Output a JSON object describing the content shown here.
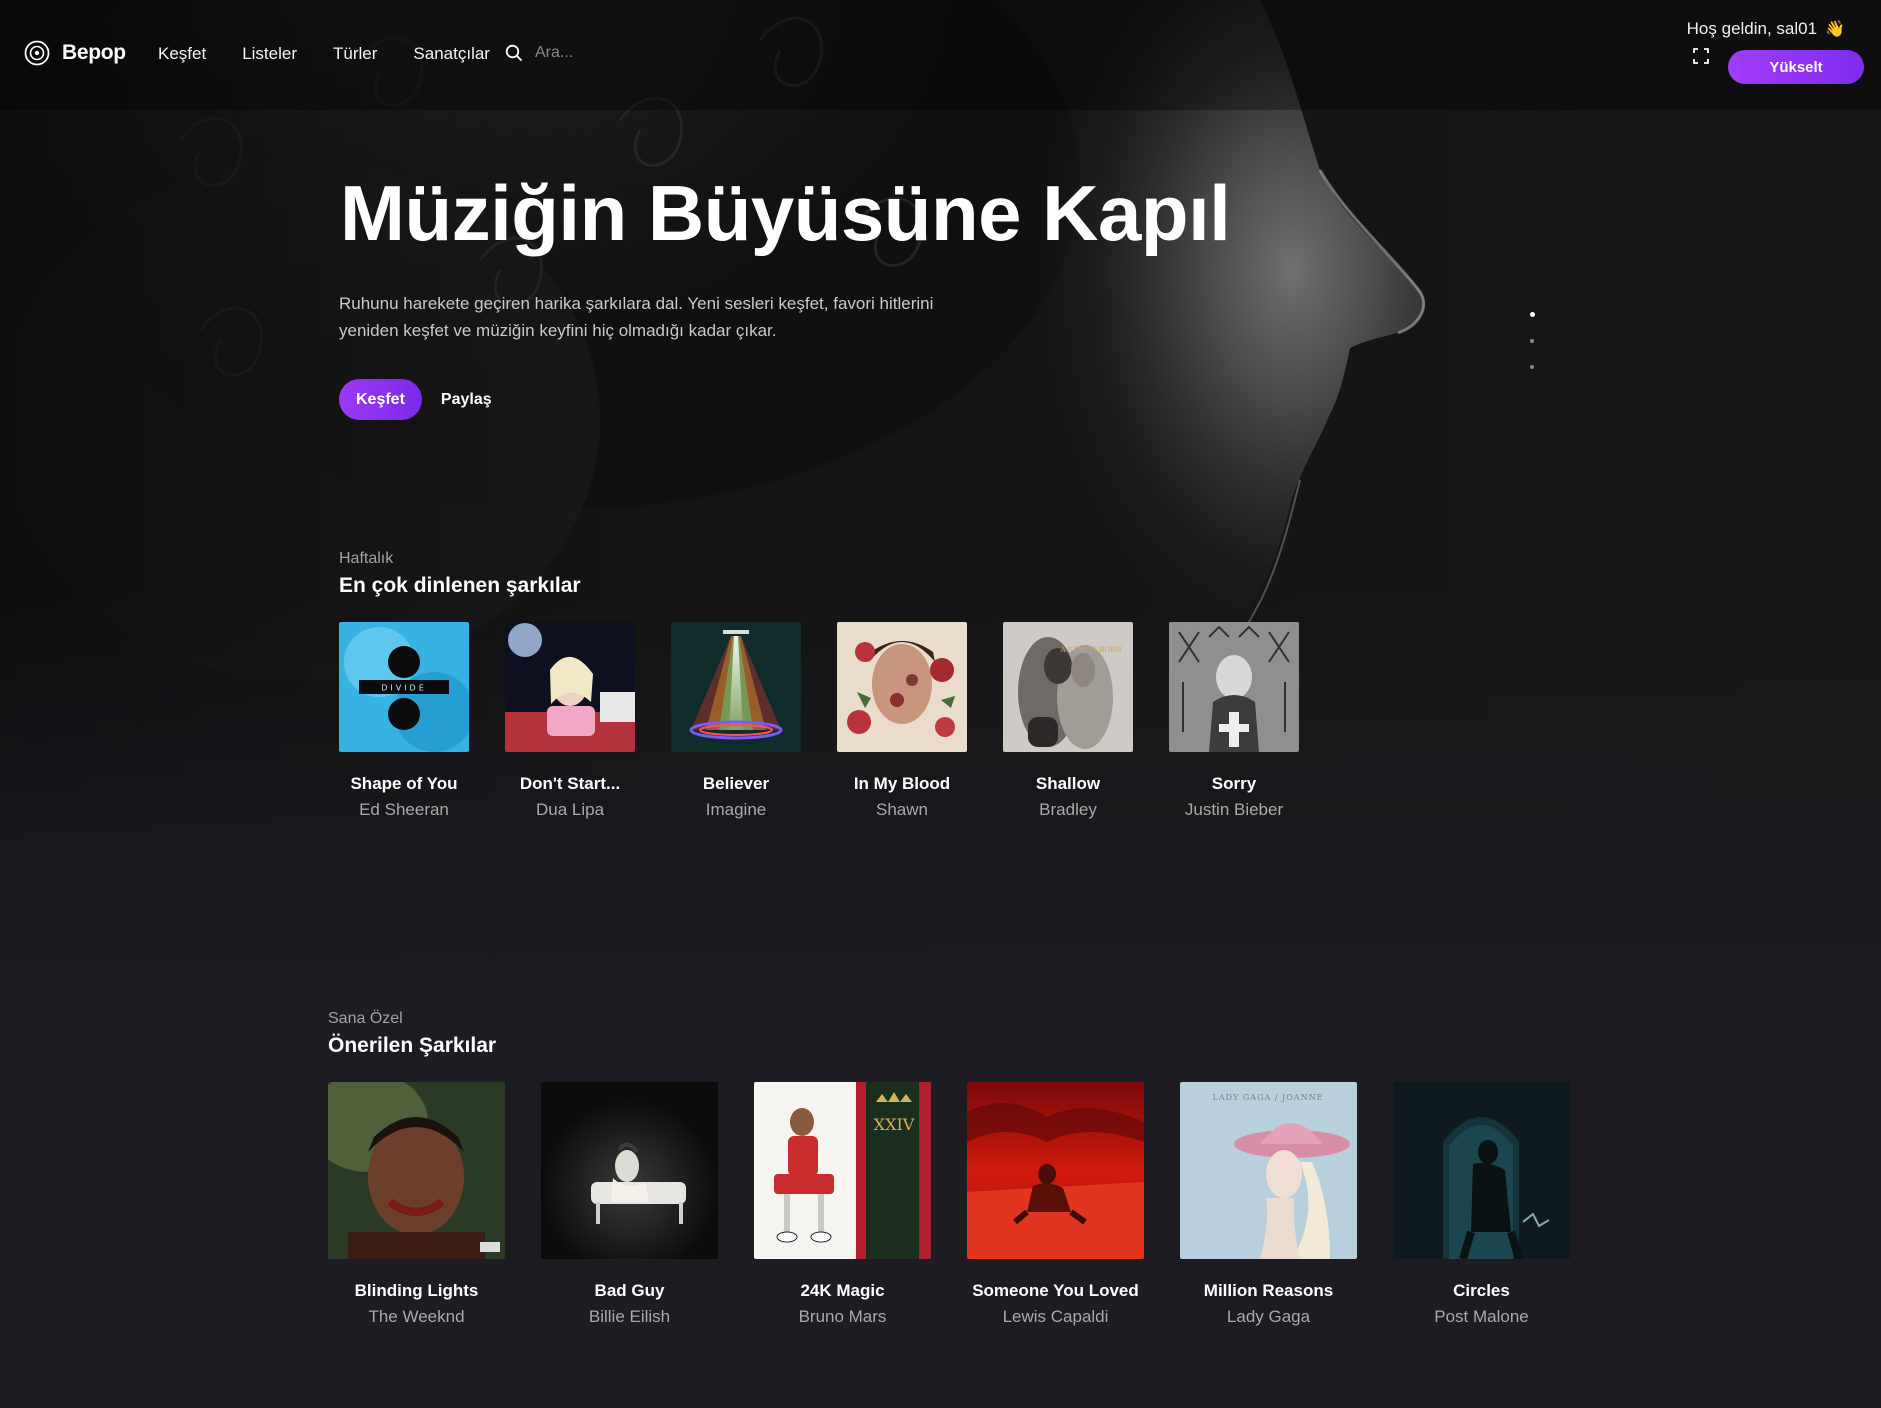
{
  "nav": {
    "logo_text": "Bepop",
    "links": [
      "Keşfet",
      "Listeler",
      "Türler",
      "Sanatçılar"
    ],
    "search_placeholder": "Ara...",
    "greeting": "Hoş geldin, sal01",
    "greeting_emoji": "👋",
    "upgrade_label": "Yükselt"
  },
  "hero": {
    "title": "Müziğin Büyüsüne Kapıl",
    "description": "Ruhunu harekete geçiren harika şarkılara dal. Yeni sesleri keşfet, favori hitlerini yeniden keşfet ve müziğin keyfini hiç olmadığı kadar çıkar.",
    "primary_button": "Keşfet",
    "secondary_button": "Paylaş",
    "slides": 3,
    "active_slide": 1
  },
  "weekly": {
    "eyebrow": "Haftalık",
    "title": "En çok dinlenen şarkılar",
    "items": [
      {
        "title": "Shape of You",
        "artist": "Ed Sheeran",
        "cover_text": "DIVIDE"
      },
      {
        "title": "Don't Start...",
        "artist": "Dua Lipa"
      },
      {
        "title": "Believer",
        "artist": "Imagine"
      },
      {
        "title": "In My Blood",
        "artist": "Shawn"
      },
      {
        "title": "Shallow",
        "artist": "Bradley",
        "cover_text": "A STAR IS BORN"
      },
      {
        "title": "Sorry",
        "artist": "Justin Bieber"
      }
    ]
  },
  "foryou": {
    "eyebrow": "Sana Özel",
    "title": "Önerilen Şarkılar",
    "items": [
      {
        "title": "Blinding Lights",
        "artist": "The Weeknd"
      },
      {
        "title": "Bad Guy",
        "artist": "Billie Eilish"
      },
      {
        "title": "24K Magic",
        "artist": "Bruno Mars",
        "cover_text": "XXIV"
      },
      {
        "title": "Someone You Loved",
        "artist": "Lewis Capaldi"
      },
      {
        "title": "Million Reasons",
        "artist": "Lady Gaga",
        "cover_text": "LADY GAGA / JOANNE"
      },
      {
        "title": "Circles",
        "artist": "Post Malone"
      }
    ]
  },
  "colors": {
    "accent": "#9b3af5",
    "page_bg": "#1c1c22"
  }
}
